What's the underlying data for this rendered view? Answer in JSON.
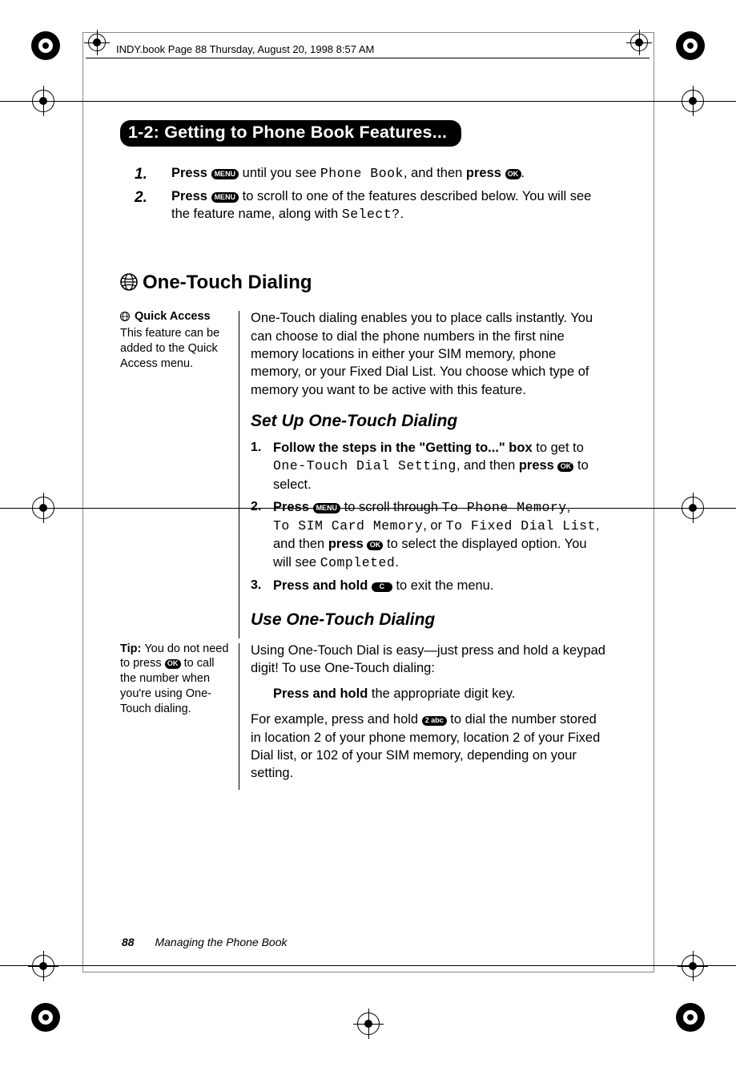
{
  "running_head": "INDY.book  Page 88  Thursday, August 20, 1998  8:57 AM",
  "section_bar": "1-2:  Getting to Phone Book Features...",
  "icons": {
    "menu_label": "MENU",
    "ok_label": "OK",
    "c_label": "C",
    "two_label": "2 abc"
  },
  "getting_to": {
    "step1": {
      "num": "1.",
      "parts": {
        "a": "Press",
        "b": " until you see ",
        "lcd1": "Phone Book",
        "c": ", and then ",
        "d": "press",
        "e": "."
      }
    },
    "step2": {
      "num": "2.",
      "parts": {
        "a": "Press",
        "b": " to scroll to one of the features described below. You will see the feature name, along with ",
        "lcd1": "Select?",
        "c": "."
      }
    }
  },
  "feature_heading": "One-Touch Dialing",
  "block1": {
    "side": {
      "label_strong": "Quick Access",
      "body": "This feature can be added to the Quick Access menu."
    },
    "intro": "One-Touch dialing enables you to place calls instantly. You can choose to dial the phone numbers in the first nine memory locations in either your SIM memory, phone memory, or your Fixed Dial List. You choose which type of memory you want to be active with this feature.",
    "sub_heading": "Set Up One-Touch Dialing",
    "steps": {
      "s1": {
        "num": "1.",
        "a": "Follow the steps in the \"Getting to...\" box",
        "b": " to get to ",
        "lcd1": "One-Touch Dial Setting",
        "c": ", and then ",
        "d": "press",
        "e": " to select."
      },
      "s2": {
        "num": "2.",
        "a": "Press",
        "b": " to scroll through ",
        "lcd1": "To Phone Memory",
        "comma1": ", ",
        "lcd2": "To SIM Card Memory",
        "comma2": ", or ",
        "lcd3": "To Fixed Dial List",
        "c": ", and then ",
        "d": "press",
        "e": " to select the displayed option. You will see ",
        "lcd4": "Completed",
        "f": "."
      },
      "s3": {
        "num": "3.",
        "a": "Press and hold",
        "b": " to exit the menu."
      }
    }
  },
  "block2": {
    "sub_heading": "Use One-Touch Dialing",
    "side": {
      "label_strong": "Tip: ",
      "body1": "You do not need to press ",
      "body2": " to call the number when you're using One-Touch dialing."
    },
    "intro": "Using One-Touch Dial is easy—just press and hold a keypad digit! To use One-Touch dialing:",
    "action": {
      "a": "Press and hold",
      "b": " the appropriate digit key."
    },
    "example": {
      "a": "For example, press and hold ",
      "b": " to dial the number stored in location 2 of your phone memory, location 2 of your Fixed Dial list, or 102 of your SIM memory, depending on your setting."
    }
  },
  "footer": {
    "page_number": "88",
    "chapter": "Managing the Phone Book"
  }
}
